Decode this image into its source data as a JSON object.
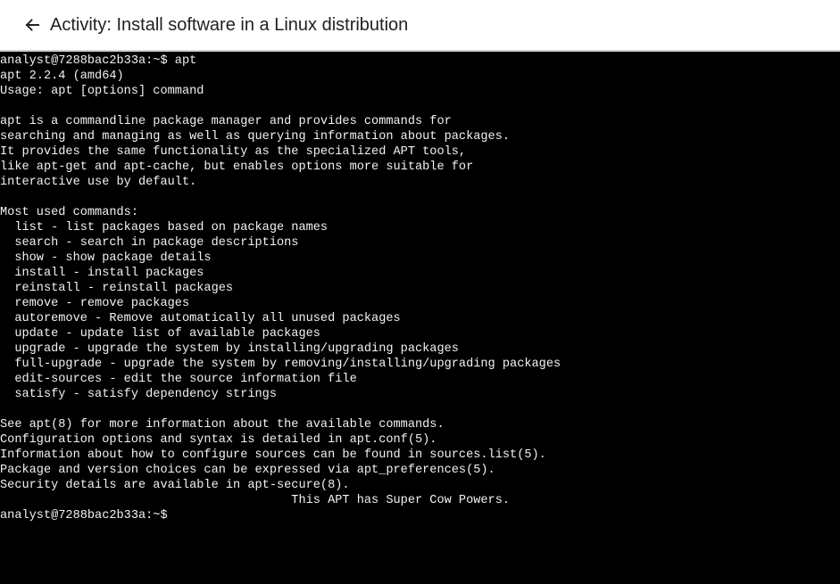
{
  "header": {
    "back_icon": "arrow-left-icon",
    "title": "Activity: Install software in a Linux distribution"
  },
  "terminal": {
    "lines": [
      "analyst@7288bac2b33a:~$ apt",
      "apt 2.2.4 (amd64)",
      "Usage: apt [options] command",
      "",
      "apt is a commandline package manager and provides commands for",
      "searching and managing as well as querying information about packages.",
      "It provides the same functionality as the specialized APT tools,",
      "like apt-get and apt-cache, but enables options more suitable for",
      "interactive use by default.",
      "",
      "Most used commands:",
      "  list - list packages based on package names",
      "  search - search in package descriptions",
      "  show - show package details",
      "  install - install packages",
      "  reinstall - reinstall packages",
      "  remove - remove packages",
      "  autoremove - Remove automatically all unused packages",
      "  update - update list of available packages",
      "  upgrade - upgrade the system by installing/upgrading packages",
      "  full-upgrade - upgrade the system by removing/installing/upgrading packages",
      "  edit-sources - edit the source information file",
      "  satisfy - satisfy dependency strings",
      "",
      "See apt(8) for more information about the available commands.",
      "Configuration options and syntax is detailed in apt.conf(5).",
      "Information about how to configure sources can be found in sources.list(5).",
      "Package and version choices can be expressed via apt_preferences(5).",
      "Security details are available in apt-secure(8).",
      "                                        This APT has Super Cow Powers.",
      "analyst@7288bac2b33a:~$"
    ]
  }
}
